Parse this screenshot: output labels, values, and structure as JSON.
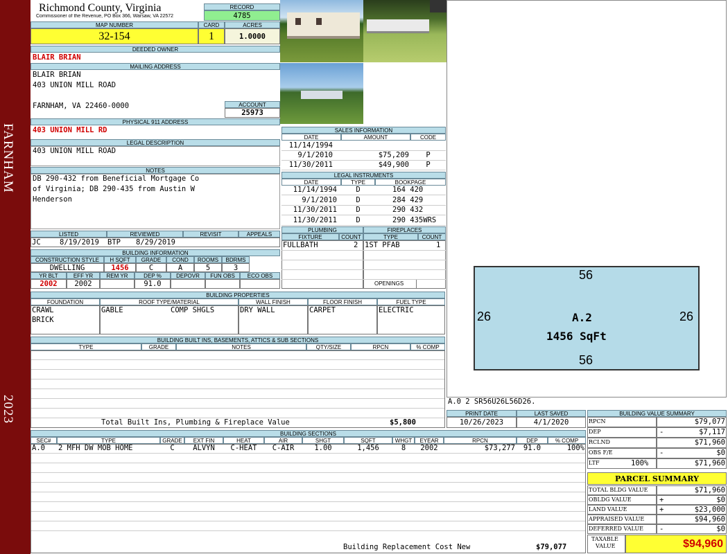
{
  "sidebar": {
    "district": "FARNHAM",
    "year": "2023"
  },
  "header": {
    "county": "Richmond County, Virginia",
    "address": "Commissioner of the Revenue, PO Box 366, Warsaw, VA 22572",
    "record_label": "RECORD",
    "record_value": "4785",
    "map_label": "MAP NUMBER",
    "map_value": "32-154",
    "card_label": "CARD",
    "card_value": "1",
    "acres_label": "ACRES",
    "acres_value": "1.0000"
  },
  "owner": {
    "deeded_label": "DEEDED OWNER",
    "deeded_value": "BLAIR BRIAN",
    "mailing_label": "MAILING ADDRESS",
    "mailing_lines": [
      "BLAIR BRIAN",
      "403 UNION MILL ROAD",
      "",
      "FARNHAM, VA 22460-0000"
    ],
    "account_label": "ACCOUNT",
    "account_value": "25973",
    "physical_label": "PHYSICAL 911 ADDRESS",
    "physical_value": "403 UNION MILL RD",
    "legal_label": "LEGAL DESCRIPTION",
    "legal_value": "403 UNION MILL ROAD",
    "notes_label": "NOTES",
    "notes_lines": [
      "DB 290-432 from Beneficial Mortgage Co",
      "of Virginia; DB 290-435 from Austin W",
      "Henderson"
    ]
  },
  "review": {
    "listed_label": "LISTED",
    "reviewed_label": "REVIEWED",
    "revisit_label": "REVISIT",
    "appeals_label": "APPEALS",
    "listed_by": "JC",
    "listed_date": "8/19/2019",
    "reviewed_by": "BTP",
    "reviewed_date": "8/29/2019"
  },
  "building_info": {
    "title": "BUILDING INFORMATION",
    "labels": [
      "CONSTRUCTION STYLE",
      "H SQFT",
      "GRADE",
      "COND",
      "ROOMS",
      "BDRMS"
    ],
    "values": [
      "DWELLING",
      "1456",
      "C",
      "A",
      "5",
      "3"
    ],
    "labels2": [
      "YR BLT",
      "EFF YR",
      "REM YR",
      "DEP %",
      "DEPOVR",
      "FUN OBS",
      "ECO OBS"
    ],
    "values2": [
      "2002",
      "2002",
      "",
      "91.0",
      "",
      "",
      ""
    ]
  },
  "sales": {
    "title": "SALES INFORMATION",
    "headers": [
      "DATE",
      "AMOUNT",
      "CODE"
    ],
    "rows": [
      [
        "11/14/1994",
        "",
        ""
      ],
      [
        "9/1/2010",
        "$75,209",
        "P"
      ],
      [
        "11/30/2011",
        "$49,900",
        "P"
      ]
    ]
  },
  "legal_instruments": {
    "title": "LEGAL INSTRUMENTS",
    "headers": [
      "DATE",
      "TYPE",
      "BOOKPAGE"
    ],
    "rows": [
      [
        "11/14/1994",
        "D",
        "164 420"
      ],
      [
        "9/1/2010",
        "D",
        "284 429"
      ],
      [
        "11/30/2011",
        "D",
        "290 432"
      ],
      [
        "11/30/2011",
        "D",
        "290 435WRS"
      ]
    ]
  },
  "plumbing": {
    "title": "PLUMBING",
    "headers": [
      "FIXTURE",
      "COUNT"
    ],
    "rows": [
      [
        "FULLBATH",
        "2"
      ]
    ]
  },
  "fireplaces": {
    "title": "FIREPLACES",
    "headers": [
      "TYPE",
      "COUNT"
    ],
    "rows": [
      [
        "1ST PFAB",
        "1"
      ]
    ],
    "openings_label": "OPENINGS"
  },
  "properties": {
    "title": "BUILDING PROPERTIES",
    "headers": [
      "FOUNDATION",
      "ROOF TYPE/MATERIAL",
      "WALL FINISH",
      "FLOOR FINISH",
      "FUEL TYPE"
    ],
    "foundation": [
      "CRAWL",
      "BRICK"
    ],
    "roof_type": "GABLE",
    "roof_material": "COMP SHGLS",
    "wall": "DRY WALL",
    "floor": "CARPET",
    "fuel": "ELECTRIC"
  },
  "builtins": {
    "title": "BUILDING BUILT INS, BASEMENTS, ATTICS & SUB SECTIONS",
    "headers": [
      "TYPE",
      "GRADE",
      "NOTES",
      "QTY/SIZE",
      "RPCN",
      "% COMP"
    ],
    "total_label": "Total Built Ins, Plumbing & Fireplace Value",
    "total_value": "$5,800"
  },
  "sketch": {
    "top": "56",
    "bottom": "56",
    "left": "26",
    "right": "26",
    "label": "A.2",
    "area": "1456 SqFt",
    "code_line": "A.0   2    SR56U26L56D26."
  },
  "dates": {
    "print_label": "PRINT DATE",
    "print_value": "10/26/2023",
    "saved_label": "LAST SAVED",
    "saved_value": "4/1/2020"
  },
  "sections": {
    "title": "BUILDING SECTIONS",
    "headers": [
      "SEC#",
      "TYPE",
      "GRADE",
      "EXT FIN",
      "HEAT",
      "AIR",
      "SHGT",
      "SQFT",
      "WHGT",
      "EYEAR",
      "RPCN",
      "DEP",
      "% COMP"
    ],
    "row": [
      "A.0",
      "2 MFH DW MOB HOME",
      "C",
      "ALVYN",
      "C-HEAT",
      "C-AIR",
      "1.00",
      "1,456",
      "8",
      "2002",
      "$73,277",
      "91.0",
      "100%"
    ],
    "total_label": "Building Replacement Cost New",
    "total_value": "$79,077"
  },
  "value_summary": {
    "title": "BUILDING VALUE SUMMARY",
    "rows": [
      {
        "label": "RPCN",
        "sign": "",
        "value": "$79,077"
      },
      {
        "label": "DEP",
        "sign": "-",
        "value": "$7,117"
      },
      {
        "label": "RCLND",
        "sign": "",
        "value": "$71,960"
      },
      {
        "label": "OBS F/E",
        "sign": "-",
        "value": "$0"
      },
      {
        "label": "LTF",
        "pct": "100%",
        "sign": "",
        "value": "$71,960"
      }
    ]
  },
  "parcel": {
    "title": "PARCEL SUMMARY",
    "rows": [
      {
        "label": "TOTAL BLDG VALUE",
        "sign": "",
        "value": "$71,960"
      },
      {
        "label": "OBLDG VALUE",
        "sign": "+",
        "value": "$0"
      },
      {
        "label": "LAND VALUE",
        "sign": "+",
        "value": "$23,000"
      },
      {
        "label": "APPRAISED VALUE",
        "sign": "",
        "value": "$94,960"
      },
      {
        "label": "DEFERRED VALUE",
        "sign": "-",
        "value": "$0"
      }
    ],
    "taxable_label_1": "TAXABLE",
    "taxable_label_2": "VALUE",
    "taxable_value": "$94,960"
  },
  "colors": {
    "sidebar": "#7a0c0c",
    "header_bg": "#b9dde8",
    "highlight": "#ffff33",
    "record_bg": "#90ee90",
    "sketch_fill": "#b5dbe8",
    "red_text": "#d00000"
  }
}
